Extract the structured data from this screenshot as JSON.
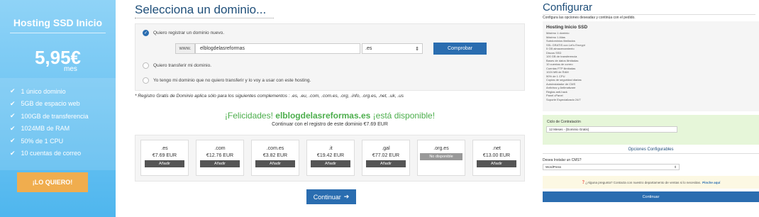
{
  "plan": {
    "title": "Hosting SSD Inicio",
    "price": "5,95€",
    "period": "mes",
    "features": [
      "1 único dominio",
      "5GB de espacio web",
      "100GB de transferencia",
      "1024MB de RAM",
      "50% de 1 CPU",
      "10 cuentas de correo"
    ],
    "cta": "¡LO QUIERO!"
  },
  "domain": {
    "title": "Selecciona un dominio...",
    "options": [
      "Quiero registrar un dominio nuevo.",
      "Quiero transferir mi dominio.",
      "Yo tengo mi dominio que no quiero transferir y lo voy a usar con este hosting."
    ],
    "www": "www.",
    "sld_value": "elblogdelasreformas",
    "tld_value": ".es",
    "check_button": "Comprobar",
    "note": "* Registro Gratis de Dominio aplica sólo para los siguientes complementos : .es, .eu, .com, .com.es, .org, .info, .org.es, .net, .uk, .us",
    "available_prefix": "¡Felicidades! ",
    "available_domain": "elblogdelasreformas.es",
    "available_suffix": " ¡está disponible!",
    "available_sub": "Continuar con el registro de este dominio €7.69 EUR",
    "suggestions": [
      {
        "tld": ".es",
        "price": "€7.69 EUR",
        "action": "Añadir"
      },
      {
        "tld": ".com",
        "price": "€12.76 EUR",
        "action": "Añadir"
      },
      {
        "tld": ".com.es",
        "price": "€3.82 EUR",
        "action": "Añadir"
      },
      {
        "tld": ".it",
        "price": "€19.42 EUR",
        "action": "Añadir"
      },
      {
        "tld": ".gal",
        "price": "€77.02 EUR",
        "action": "Añadir"
      },
      {
        "tld": ".org.es",
        "price": "",
        "action": "No disponible"
      },
      {
        "tld": ".net",
        "price": "€13.00 EUR",
        "action": "Añadir"
      }
    ],
    "continue": "Continuar"
  },
  "config": {
    "title": "Configurar",
    "subtitle": "Configura las opciones deseadas y continúa con el pedido.",
    "product_name": "Hosting Inicio SSD",
    "product_features": [
      "Máximo 1 dominio",
      "Máximo 1 Alias",
      "Subdominios ilimitados",
      "SSL GRATIS con Let's Encrypt",
      "5 GB almacenamiento",
      "Discos SSD",
      "100 GB de transferencia",
      "Bases de datos ilimitadas",
      "10 cuentas de correo",
      "Cuentas FTP ilimitadas",
      "1024 MB de RAM",
      "50% de 1 CPU",
      "Copias de seguridad diarias",
      "Autoinstalador de CMS",
      "Antivirus y Antimalware",
      "Reglas anti-hack",
      "Panel cPanel",
      "Soporte Especializado 24/7"
    ],
    "cycle_label": "Ciclo de Contratación",
    "cycle_value": "12 Meses - (Dominio Gratis)",
    "options_title": "Opciones Configurables",
    "cms_label": "Desea Instalar un CMS?",
    "cms_value": "WordPress",
    "help_text": "¿Alguna pregunta? Contacta con nuestro departamento de ventas si lo necesitas.",
    "help_link": "Pinche aquí",
    "continue": "Continuar"
  }
}
